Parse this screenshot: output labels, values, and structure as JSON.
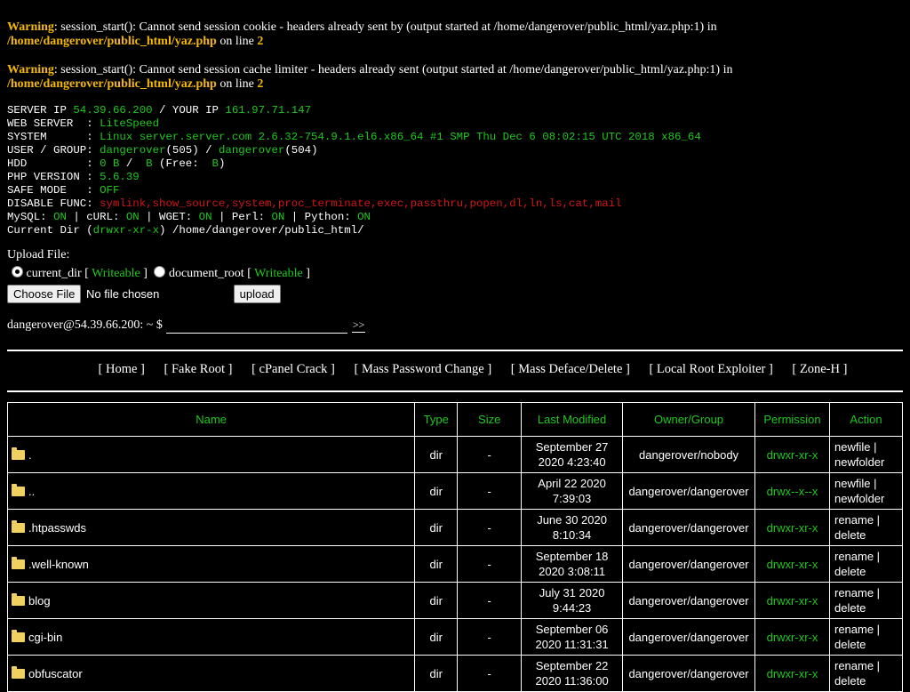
{
  "warnings": [
    {
      "label": "Warning",
      "message": ": session_start(): Cannot send session cookie - headers already sent by (output started at /home/dangerover/public_html/yaz.php:1) in",
      "file": "/home/dangerover/public_html/yaz.php",
      "on_line": " on line ",
      "line": "2"
    },
    {
      "label": "Warning",
      "message": ": session_start(): Cannot send session cache limiter - headers already sent (output started at /home/dangerover/public_html/yaz.php:1) in",
      "file": "/home/dangerover/public_html/yaz.php",
      "on_line": " on line ",
      "line": "2"
    }
  ],
  "info": {
    "server_ip_label": "SERVER IP ",
    "server_ip": "54.39.66.200",
    "your_ip_label": " / YOUR IP ",
    "your_ip": "161.97.71.147",
    "web_server_label": "WEB SERVER  : ",
    "web_server": "LiteSpeed",
    "system_label": "SYSTEM      : ",
    "system": "Linux server.server.com 2.6.32-754.9.1.el6.x86_64 #1 SMP Thu Dec 6 08:02:15 UTC 2018 x86_64",
    "user_label": "USER / GROUP: ",
    "user": "dangerover",
    "user_id": "(505)",
    "slash": " / ",
    "group": "dangerover",
    "group_id": "(504)",
    "hdd_label": "HDD         : ",
    "hdd_used": "0 B",
    "hdd_sep": " /  ",
    "hdd_total": "B",
    "hdd_free_label": " (Free:  ",
    "hdd_free": "B",
    "hdd_close": ")",
    "php_label": "PHP VERSION : ",
    "php": "5.6.39",
    "safe_label": "SAFE MODE   : ",
    "safe": "OFF",
    "disable_label": "DISABLE FUNC: ",
    "disable": "symlink,show_source,system,proc_terminate,exec,passthru,popen,dl,ln,ls,cat,mail",
    "mysql_label": "MySQL: ",
    "mysql": "ON",
    "curl_label": " | cURL: ",
    "curl": "ON",
    "wget_label": " | WGET: ",
    "wget": "ON",
    "perl_label": " | Perl: ",
    "perl": "ON",
    "python_label": " | Python: ",
    "python": "ON",
    "dir_label": "Current Dir (",
    "dir_perm": "drwxr-xr-x",
    "dir_path": ") /home/dangerover/public_html/"
  },
  "upload": {
    "title": "Upload File:",
    "opt1": "current_dir",
    "opt1_open": " [ ",
    "opt1_status": "Writeable",
    "opt1_close": " ]",
    "opt2": "document_root",
    "opt2_open": " [ ",
    "opt2_status": "Writeable",
    "opt2_close": " ]",
    "choose_label": "Choose File",
    "no_file": "No file chosen",
    "upload_label": "upload"
  },
  "command": {
    "prompt": "dangerover@54.39.66.200: ~ $",
    "go": ">>"
  },
  "menu": [
    "[ Home ]",
    "[ Fake Root ]",
    "[ cPanel Crack ]",
    "[ Mass Password Change ]",
    "[ Mass Deface/Delete ]",
    "[ Local Root Exploiter ]",
    "[ Zone-H ]"
  ],
  "table": {
    "headers": [
      "Name",
      "Type",
      "Size",
      "Last Modified",
      "Owner/Group",
      "Permission",
      "Action"
    ],
    "rows": [
      {
        "name": ".",
        "type": "dir",
        "size": "-",
        "date": "September 27",
        "time": "2020 4:23:40",
        "owner": "dangerover/nobody",
        "perm": "drwxr-xr-x",
        "act1": "newfile |",
        "act2": "newfolder"
      },
      {
        "name": "..",
        "type": "dir",
        "size": "-",
        "date": "April 22 2020",
        "time": "7:39:03",
        "owner": "dangerover/dangerover",
        "perm": "drwx--x--x",
        "act1": "newfile |",
        "act2": "newfolder"
      },
      {
        "name": ".htpasswds",
        "type": "dir",
        "size": "-",
        "date": "June 30 2020",
        "time": "8:10:34",
        "owner": "dangerover/dangerover",
        "perm": "drwxr-xr-x",
        "act1": "rename |",
        "act2": "delete"
      },
      {
        "name": ".well-known",
        "type": "dir",
        "size": "-",
        "date": "September 18",
        "time": "2020 3:08:11",
        "owner": "dangerover/dangerover",
        "perm": "drwxr-xr-x",
        "act1": "rename |",
        "act2": "delete"
      },
      {
        "name": "blog",
        "type": "dir",
        "size": "-",
        "date": "July 31 2020",
        "time": "9:44:23",
        "owner": "dangerover/dangerover",
        "perm": "drwxr-xr-x",
        "act1": "rename |",
        "act2": "delete"
      },
      {
        "name": "cgi-bin",
        "type": "dir",
        "size": "-",
        "date": "September 06",
        "time": "2020 11:31:31",
        "owner": "dangerover/dangerover",
        "perm": "drwxr-xr-x",
        "act1": "rename |",
        "act2": "delete"
      },
      {
        "name": "obfuscator",
        "type": "dir",
        "size": "-",
        "date": "September 22",
        "time": "2020 11:36:00",
        "owner": "dangerover/dangerover",
        "perm": "drwxr-xr-x",
        "act1": "rename |",
        "act2": "delete"
      }
    ]
  }
}
